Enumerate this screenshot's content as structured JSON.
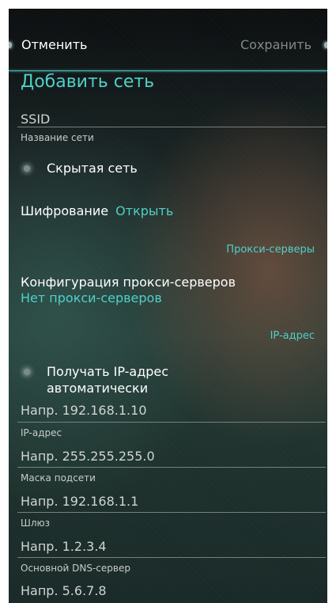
{
  "toolbar": {
    "cancel_label": "Отменить",
    "save_label": "Сохранить"
  },
  "page": {
    "title": "Добавить сеть"
  },
  "ssid": {
    "placeholder": "SSID",
    "label": "Название сети"
  },
  "hidden_network": {
    "label": "Скрытая сеть"
  },
  "encryption": {
    "label": "Шифрование",
    "value": "Открыть"
  },
  "proxy": {
    "section_title": "Прокси-серверы",
    "config_label": "Конфигурация прокси-серверов",
    "config_value": "Нет прокси-серверов"
  },
  "ip_section": {
    "section_title": "IP-адрес",
    "auto_line1": "Получать IP-адрес",
    "auto_line2": "автоматически"
  },
  "fields": [
    {
      "placeholder": "Напр. 192.168.1.10",
      "label": "IP-адрес"
    },
    {
      "placeholder": "Напр. 255.255.255.0",
      "label": "Маска подсети"
    },
    {
      "placeholder": "Напр. 192.168.1.1",
      "label": "Шлюз"
    },
    {
      "placeholder": "Напр. 1.2.3.4",
      "label": "Основной DNS-сервер"
    },
    {
      "placeholder": "Напр. 5.6.7.8"
    }
  ],
  "colors": {
    "accent": "#4fd0c8",
    "disabled": "#7f8a88",
    "text": "#ffffff"
  }
}
